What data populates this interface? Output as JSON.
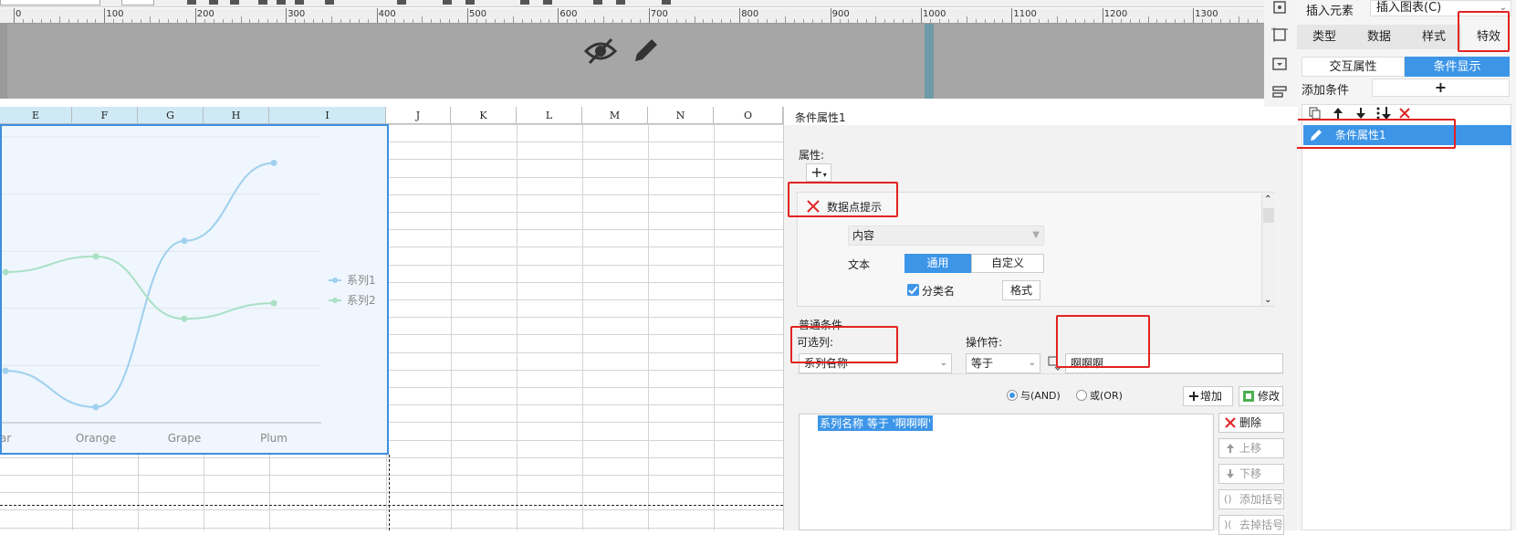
{
  "ruler": {
    "labels": [
      "0",
      "100",
      "200",
      "300",
      "400",
      "500",
      "600",
      "700",
      "800",
      "900",
      "1000",
      "1100",
      "1200",
      "1300"
    ]
  },
  "sheet": {
    "columns": [
      "E",
      "F",
      "G",
      "H",
      "I",
      "J",
      "K",
      "L",
      "M",
      "N",
      "O"
    ],
    "selected_columns": [
      "E",
      "F",
      "G",
      "H",
      "I"
    ]
  },
  "chart_data": {
    "type": "line",
    "categories": [
      "Pear",
      "Orange",
      "Grape",
      "Plum"
    ],
    "visible_category_labels": [
      "ar",
      "Orange",
      "Grape",
      "Plum"
    ],
    "series": [
      {
        "name": "系列1",
        "values": [
          20,
          6,
          70,
          100
        ],
        "color": "#9fd0ee"
      },
      {
        "name": "系列2",
        "values": [
          58,
          64,
          40,
          46
        ],
        "color": "#a9e0c4"
      }
    ],
    "ylim": [
      0,
      110
    ],
    "legend": "right",
    "grid": true
  },
  "right_panel": {
    "insert_element": "插入元素",
    "insert_chart": "插入图表(C)",
    "tabs": [
      "类型",
      "数据",
      "样式",
      "特效"
    ],
    "sub_tabs": [
      "交互属性",
      "条件显示"
    ],
    "add_condition": "添加条件",
    "add_plus": "+",
    "condition_item": "条件属性1"
  },
  "middle_panel": {
    "title": "条件属性1",
    "attributes_label": "属性:",
    "add_btn": "+",
    "item_label": "数据点提示",
    "content_label": "内容",
    "text_label": "文本",
    "text_mode_general": "通用",
    "text_mode_custom": "自定义",
    "category_name_checkbox": "分类名",
    "format_btn": "格式",
    "general_conditions": "普通条件",
    "optional_column": "可选列:",
    "operator": "操作符:",
    "column_value": "系列名称",
    "operator_value": "等于",
    "operand_value": "啊啊啊",
    "and_label": "与(AND)",
    "or_label": "或(OR)",
    "add_btn_label": "增加",
    "modify_btn_label": "修改",
    "condition_text": "系列名称 等于 '啊啊啊'",
    "delete_label": "删除",
    "move_up_label": "上移",
    "move_down_label": "下移",
    "add_bracket_label": "添加括号",
    "remove_bracket_label": "去掉括号"
  }
}
